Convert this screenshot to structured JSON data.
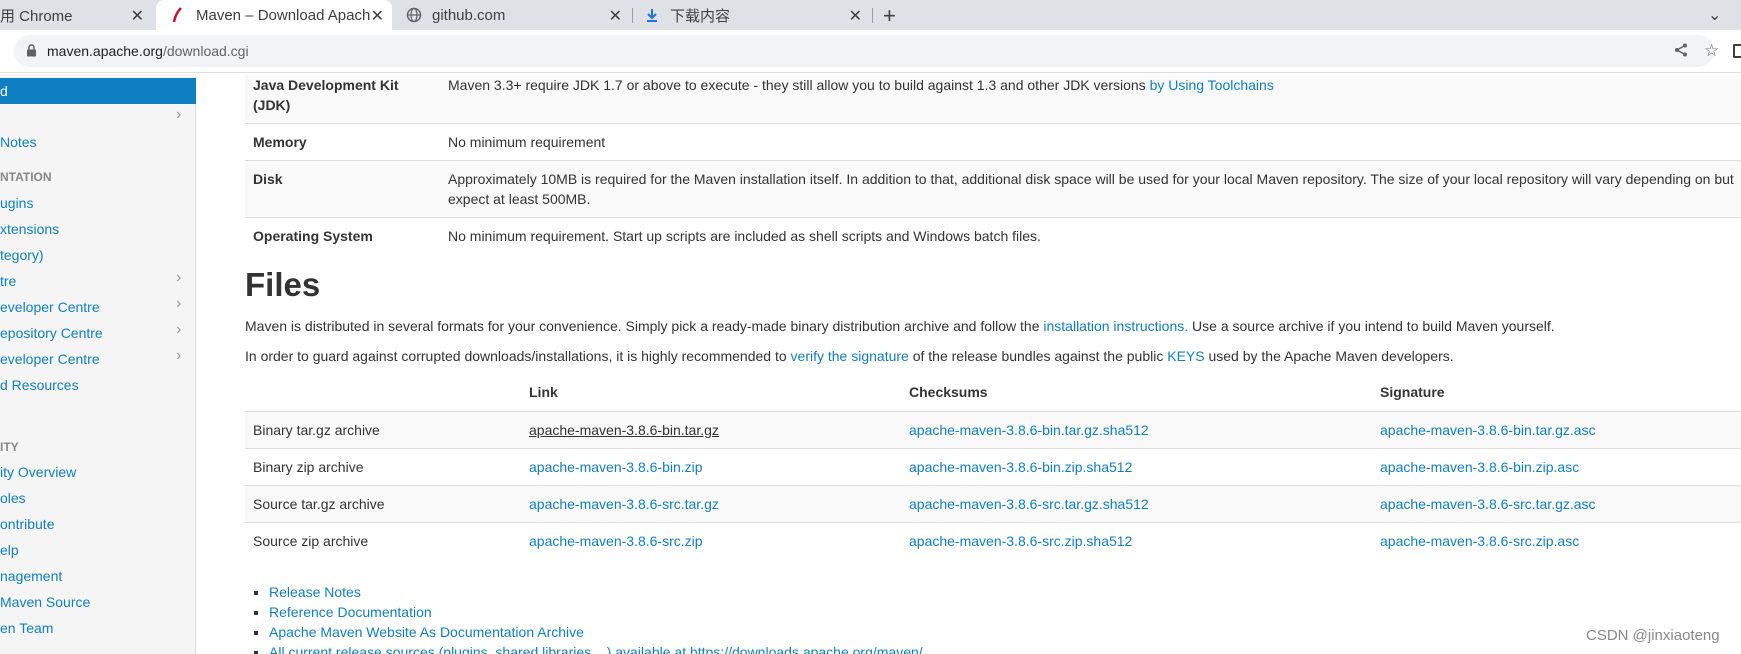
{
  "tabs": [
    {
      "label": "用 Chrome",
      "active": false
    },
    {
      "label": "Maven – Download Apache",
      "active": true
    },
    {
      "label": "github.com",
      "active": false
    },
    {
      "label": "下载内容",
      "active": false
    }
  ],
  "omnibox": {
    "host": "maven.apache.org",
    "path": "/download.cgi"
  },
  "sidebar": {
    "active_item": "d",
    "items": [
      {
        "label": "Notes",
        "chevron": false
      },
      {
        "label": "NTATION",
        "header": true
      },
      {
        "label": "ugins",
        "chevron": false
      },
      {
        "label": "xtensions",
        "chevron": false
      },
      {
        "label": "tegory)",
        "chevron": false
      },
      {
        "label": "tre",
        "chevron": true
      },
      {
        "label": "eveloper Centre",
        "chevron": true
      },
      {
        "label": "epository Centre",
        "chevron": true
      },
      {
        "label": "eveloper Centre",
        "chevron": true
      },
      {
        "label": "d Resources",
        "chevron": false
      },
      {
        "label": "ITY",
        "header": true
      },
      {
        "label": "ity Overview",
        "chevron": false
      },
      {
        "label": "oles",
        "chevron": false
      },
      {
        "label": "ontribute",
        "chevron": false
      },
      {
        "label": "elp",
        "chevron": false
      },
      {
        "label": "nagement",
        "chevron": false
      },
      {
        "label": "Maven Source",
        "chevron": false
      },
      {
        "label": "en Team",
        "chevron": false
      }
    ]
  },
  "requirements": [
    {
      "label": "Java Development Kit (JDK)",
      "text": "Maven 3.3+ require JDK 1.7 or above to execute - they still allow you to build against 1.3 and other JDK versions ",
      "link": "by Using Toolchains"
    },
    {
      "label": "Memory",
      "text": "No minimum requirement",
      "link": ""
    },
    {
      "label": "Disk",
      "text": "Approximately 10MB is required for the Maven installation itself. In addition to that, additional disk space will be used for your local Maven repository. The size of your local repository will vary depending on but expect at least 500MB.",
      "link": ""
    },
    {
      "label": "Operating System",
      "text": "No minimum requirement. Start up scripts are included as shell scripts and Windows batch files.",
      "link": ""
    }
  ],
  "files": {
    "heading": "Files",
    "p1_a": "Maven is distributed in several formats for your convenience. Simply pick a ready-made binary distribution archive and follow the ",
    "p1_link": "installation instructions.",
    "p1_b": " Use a source archive if you intend to build Maven yourself.",
    "p2_a": "In order to guard against corrupted downloads/installations, it is highly recommended to ",
    "p2_link1": "verify the signature",
    "p2_b": " of the release bundles against the public ",
    "p2_link2": "KEYS",
    "p2_c": " used by the Apache Maven developers.",
    "headers": [
      "",
      "Link",
      "Checksums",
      "Signature"
    ],
    "rows": [
      {
        "name": "Binary tar.gz archive",
        "link": "apache-maven-3.8.6-bin.tar.gz",
        "checksum": "apache-maven-3.8.6-bin.tar.gz.sha512",
        "signature": "apache-maven-3.8.6-bin.tar.gz.asc"
      },
      {
        "name": "Binary zip archive",
        "link": "apache-maven-3.8.6-bin.zip",
        "checksum": "apache-maven-3.8.6-bin.zip.sha512",
        "signature": "apache-maven-3.8.6-bin.zip.asc"
      },
      {
        "name": "Source tar.gz archive",
        "link": "apache-maven-3.8.6-src.tar.gz",
        "checksum": "apache-maven-3.8.6-src.tar.gz.sha512",
        "signature": "apache-maven-3.8.6-src.tar.gz.asc"
      },
      {
        "name": "Source zip archive",
        "link": "apache-maven-3.8.6-src.zip",
        "checksum": "apache-maven-3.8.6-src.zip.sha512",
        "signature": "apache-maven-3.8.6-src.zip.asc"
      }
    ],
    "links": [
      "Release Notes",
      "Reference Documentation",
      "Apache Maven Website As Documentation Archive",
      "All current release sources (plugins, shared libraries,...) available at https://downloads.apache.org/maven/"
    ]
  },
  "watermark": "CSDN @jinxiaoteng",
  "colors": {
    "link": "#0f7fc4",
    "sidebar_active": "#0f7fc4"
  }
}
